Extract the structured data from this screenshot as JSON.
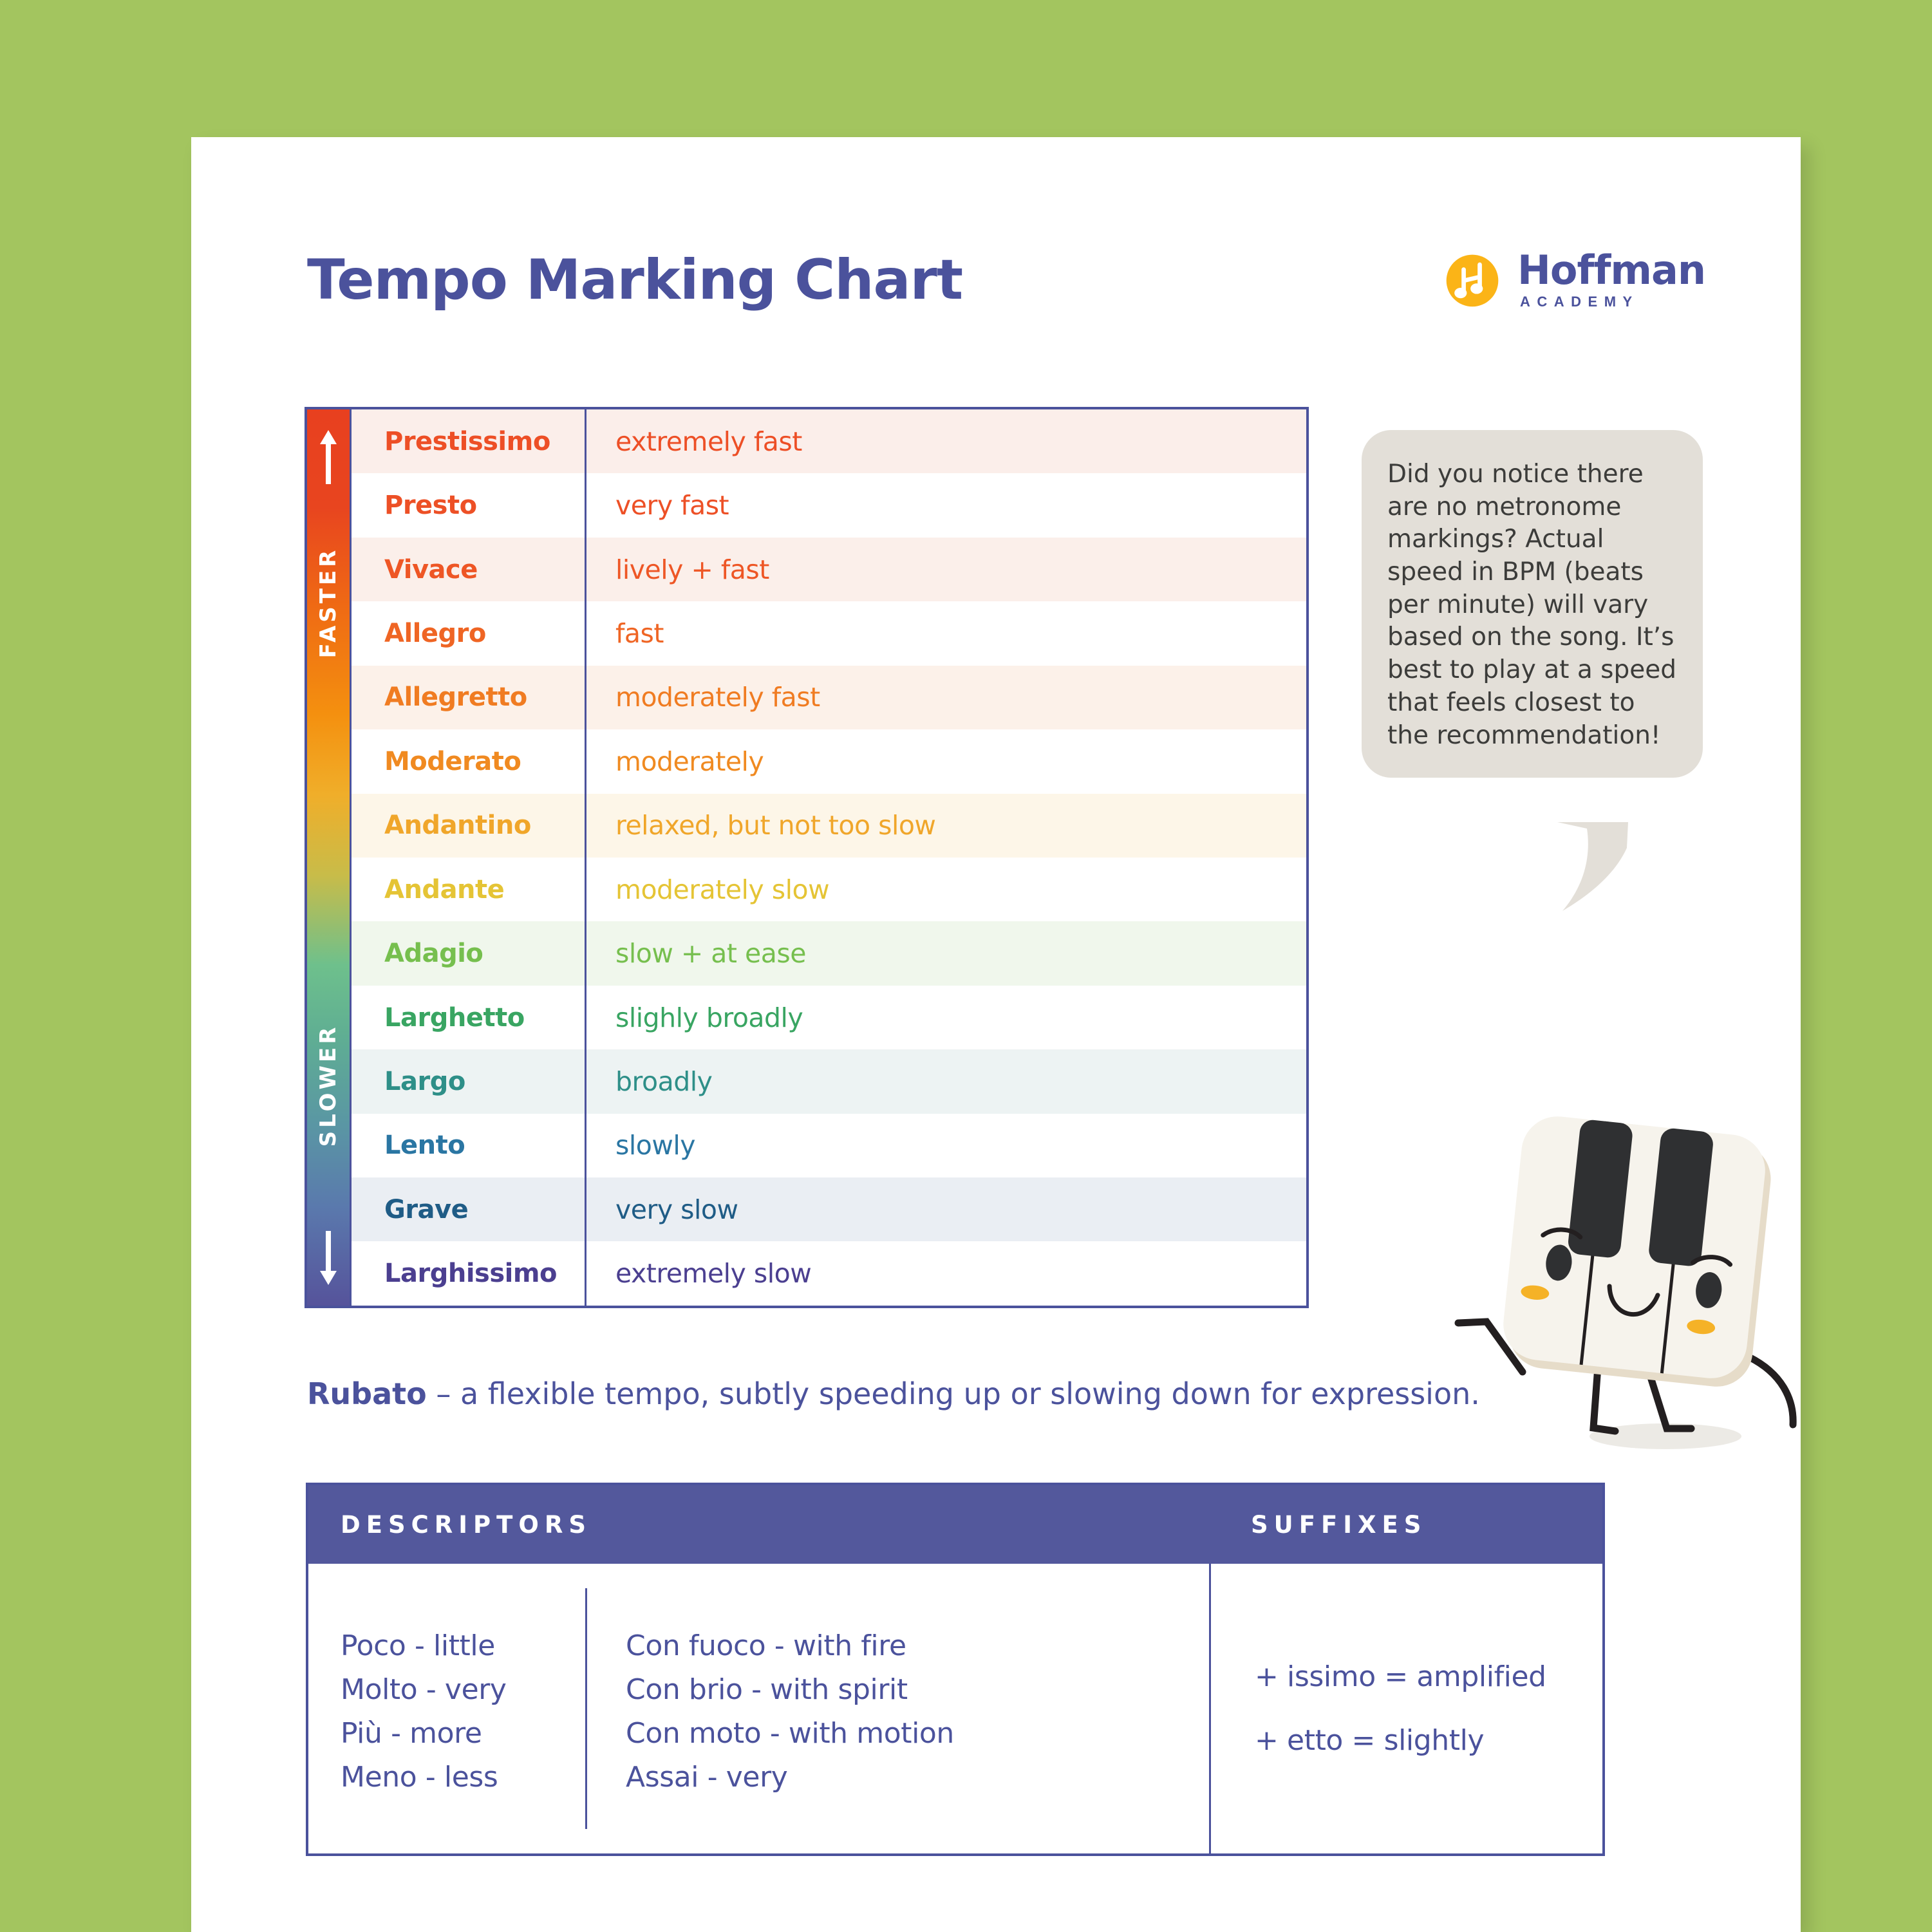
{
  "header": {
    "title": "Tempo Marking Chart",
    "logo": {
      "name": "Hoffman",
      "subtitle": "ACADEMY",
      "mark_color": "#fbb417",
      "text_color": "#4b529c"
    }
  },
  "colors": {
    "page_background": "#a3c55f",
    "sheet": "#ffffff",
    "brand_blue": "#4b529c",
    "header_fill": "#53589c",
    "bubble_fill": "#e3dfd8",
    "gradient_top": "#e8401f",
    "gradient_bottom": "#56539b"
  },
  "tempo_table": {
    "axis": {
      "faster_label": "FASTER",
      "slower_label": "SLOWER",
      "up_arrow_icon": "arrow-up-icon",
      "down_arrow_icon": "arrow-down-icon"
    },
    "rows": [
      {
        "term": "Prestissimo",
        "definition": "extremely fast",
        "color": "#ed4f26",
        "row_bg": "#fbeeea"
      },
      {
        "term": "Presto",
        "definition": "very fast",
        "color": "#ed5026",
        "row_bg": "#ffffff"
      },
      {
        "term": "Vivace",
        "definition": "lively + fast",
        "color": "#ee5625",
        "row_bg": "#fbefea"
      },
      {
        "term": "Allegro",
        "definition": "fast",
        "color": "#ef6524",
        "row_bg": "#ffffff"
      },
      {
        "term": "Allegretto",
        "definition": "moderately fast",
        "color": "#f07c22",
        "row_bg": "#fcf1e9"
      },
      {
        "term": "Moderato",
        "definition": "moderately",
        "color": "#f08a21",
        "row_bg": "#ffffff"
      },
      {
        "term": "Andantino",
        "definition": "relaxed, but not too slow",
        "color": "#f0a62a",
        "row_bg": "#fdf6e8"
      },
      {
        "term": "Andante",
        "definition": "moderately slow",
        "color": "#e5c435",
        "row_bg": "#ffffff"
      },
      {
        "term": "Adagio",
        "definition": "slow + at ease",
        "color": "#76bf4e",
        "row_bg": "#f0f7ec"
      },
      {
        "term": "Larghetto",
        "definition": "slighly broadly",
        "color": "#39a562",
        "row_bg": "#ffffff"
      },
      {
        "term": "Largo",
        "definition": "broadly",
        "color": "#2e8f88",
        "row_bg": "#edf3f3"
      },
      {
        "term": "Lento",
        "definition": "slowly",
        "color": "#2a76a3",
        "row_bg": "#ffffff"
      },
      {
        "term": "Grave",
        "definition": "very slow",
        "color": "#1f5c86",
        "row_bg": "#eaeef3"
      },
      {
        "term": "Larghissimo",
        "definition": "extremely slow",
        "color": "#4b3f90",
        "row_bg": "#ffffff"
      }
    ]
  },
  "callout": {
    "text": "Did you notice there are no metronome markings? Actual speed in BPM (beats per minute) will vary based on the song. It’s best to play at a speed that feels closest to the recommendation!"
  },
  "mascot": {
    "name": "piano-key-mascot"
  },
  "rubato": {
    "term": "Rubato",
    "definition": " –  a flexible tempo, subtly speeding up or slowing down for expression."
  },
  "reference_table": {
    "headers": {
      "descriptors": "DESCRIPTORS",
      "suffixes": "SUFFIXES"
    },
    "descriptors_col1": [
      "Poco - little",
      "Molto - very",
      "Più - more",
      "Meno - less"
    ],
    "descriptors_col2": [
      "Con fuoco - with fire",
      "Con brio - with spirit",
      "Con moto - with motion",
      "Assai - very"
    ],
    "suffixes": [
      "+ issimo = amplified",
      "+ etto = slightly"
    ]
  }
}
